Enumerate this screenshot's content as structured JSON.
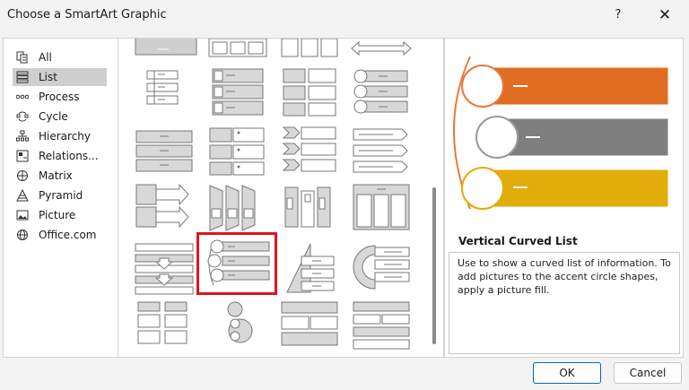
{
  "dialog": {
    "title": "Choose a SmartArt Graphic",
    "help_label": "?",
    "close_label": "✕"
  },
  "categories": [
    {
      "label": "All",
      "icon": "all-icon"
    },
    {
      "label": "List",
      "icon": "list-icon",
      "selected": true
    },
    {
      "label": "Process",
      "icon": "process-icon"
    },
    {
      "label": "Cycle",
      "icon": "cycle-icon"
    },
    {
      "label": "Hierarchy",
      "icon": "hierarchy-icon"
    },
    {
      "label": "Relations...",
      "icon": "relationship-icon"
    },
    {
      "label": "Matrix",
      "icon": "matrix-icon"
    },
    {
      "label": "Pyramid",
      "icon": "pyramid-icon"
    },
    {
      "label": "Picture",
      "icon": "picture-icon"
    },
    {
      "label": "Office.com",
      "icon": "globe-icon"
    }
  ],
  "preview": {
    "name": "Vertical Curved List",
    "description": "Use to show a curved list of information. To add pictures to the accent circle shapes, apply a picture fill.",
    "bar_colors": [
      "#e06d21",
      "#7f7f7f",
      "#e2ac0b"
    ],
    "accent_line_color": "#e8793a"
  },
  "buttons": {
    "ok": "OK",
    "cancel": "Cancel"
  },
  "colors": {
    "selection_outline": "#e0141e",
    "primary_border": "#0067c0"
  }
}
